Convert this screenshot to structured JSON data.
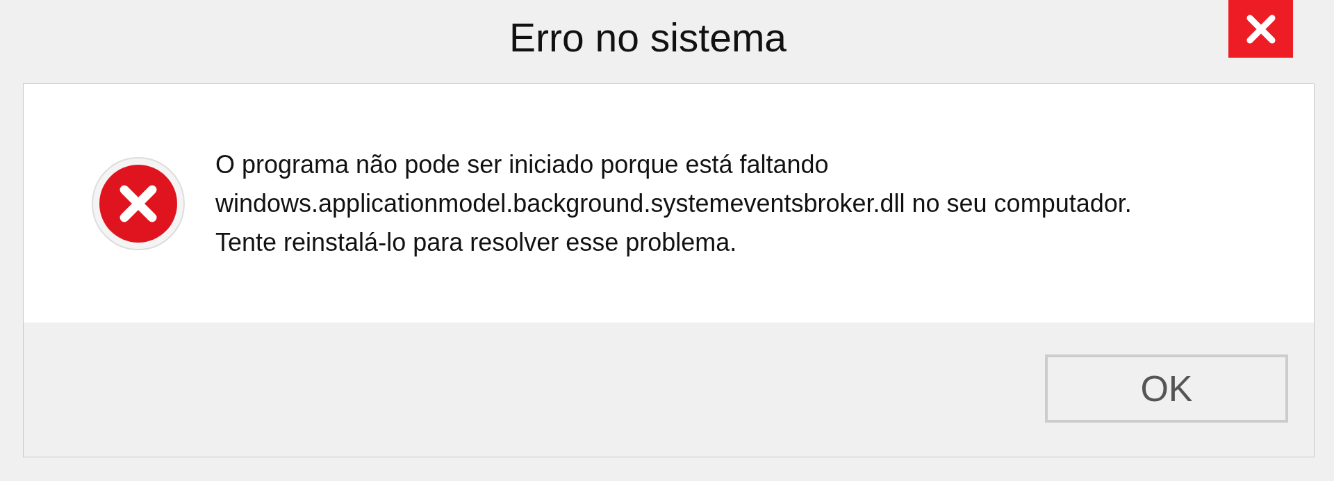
{
  "window": {
    "title": "Erro no sistema"
  },
  "message": "O programa não pode ser iniciado porque está faltando windows.applicationmodel.background.systemeventsbroker.dll no seu computador. Tente reinstalá-lo para resolver esse problema.",
  "buttons": [
    "OK"
  ]
}
